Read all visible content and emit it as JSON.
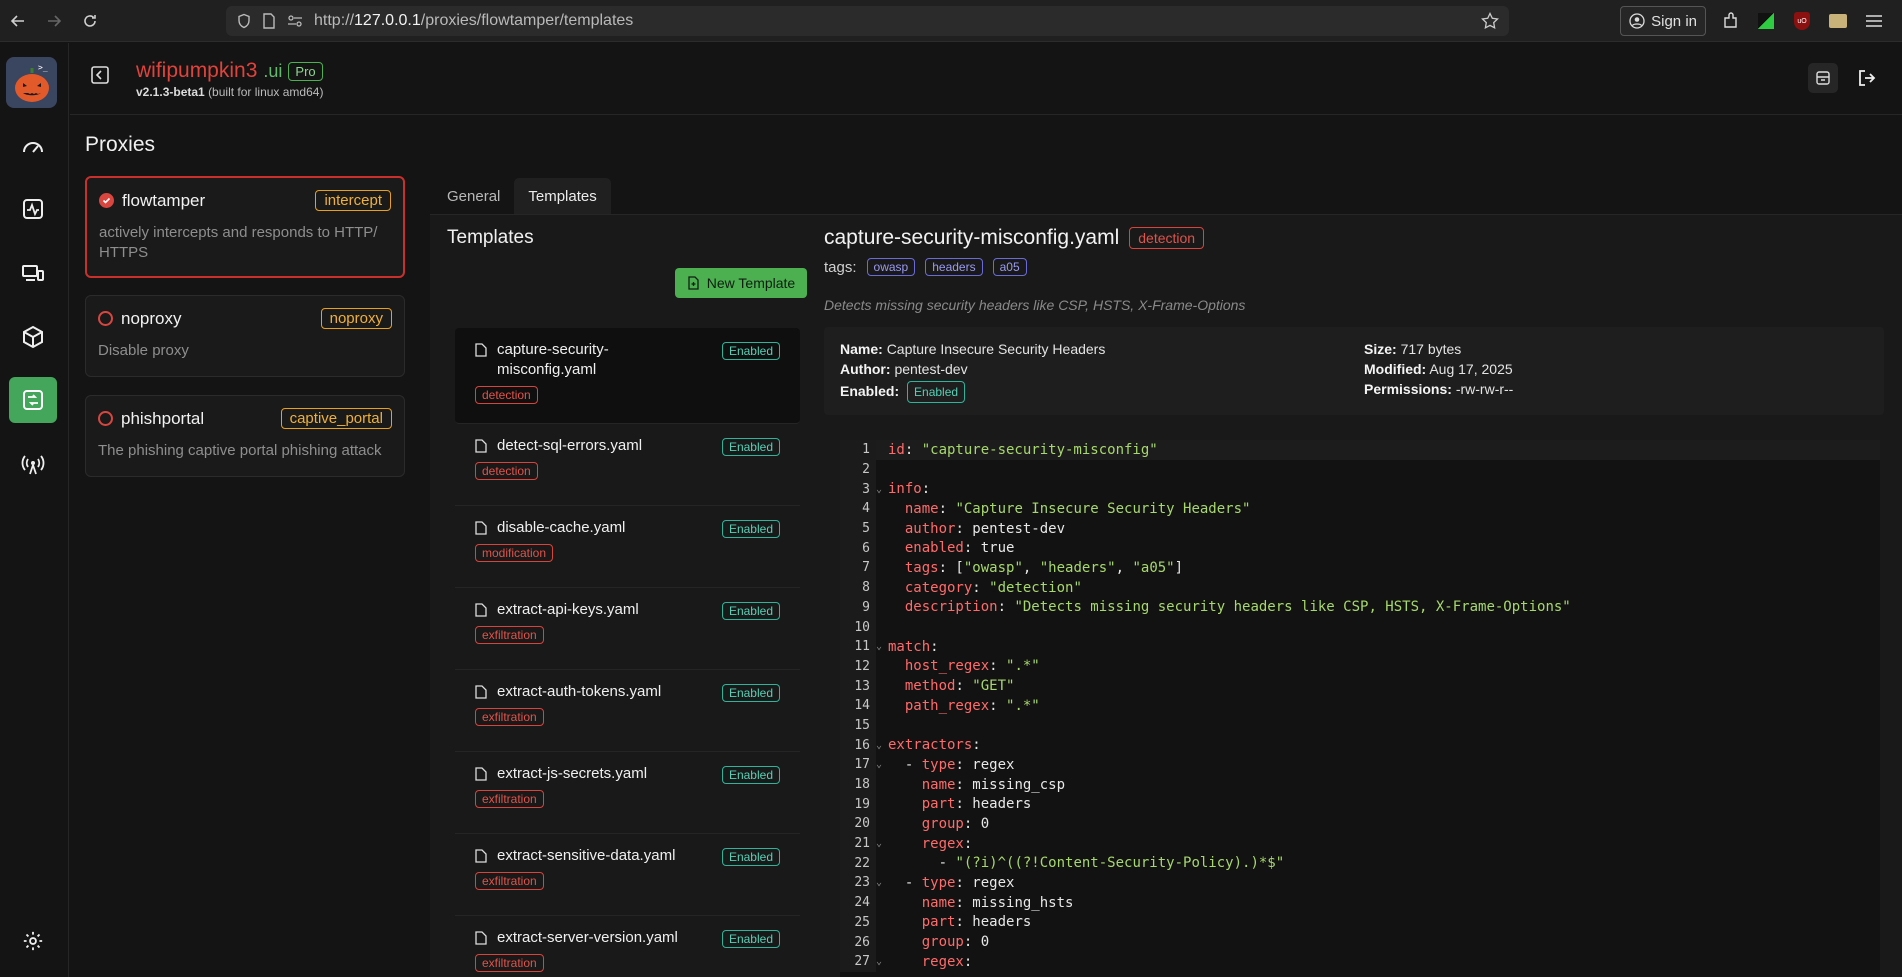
{
  "browser": {
    "url_prefix": "http://",
    "url_host": "127.0.0.1",
    "url_path": "/proxies/flowtamper/templates",
    "sign_in_label": "Sign in"
  },
  "header": {
    "brand_name": "wifipumpkin3",
    "brand_suffix": ".ui",
    "badge": "Pro",
    "version": "v2.1.3-beta1",
    "build": "(built for linux amd64)"
  },
  "page": {
    "title": "Proxies"
  },
  "proxies": [
    {
      "name": "flowtamper",
      "type": "intercept",
      "description": "actively intercepts and responds to HTTP/ HTTPS",
      "selected": true
    },
    {
      "name": "noproxy",
      "type": "noproxy",
      "description": "Disable proxy",
      "selected": false
    },
    {
      "name": "phishportal",
      "type": "captive_portal",
      "description": "The phishing captive portal phishing attack",
      "selected": false
    }
  ],
  "tabs": [
    "General",
    "Templates"
  ],
  "templates_panel": {
    "title": "Templates",
    "new_button": "New Template",
    "items": [
      {
        "name": "capture-security-misconfig.yaml",
        "status": "Enabled",
        "category": "detection"
      },
      {
        "name": "detect-sql-errors.yaml",
        "status": "Enabled",
        "category": "detection"
      },
      {
        "name": "disable-cache.yaml",
        "status": "Enabled",
        "category": "modification"
      },
      {
        "name": "extract-api-keys.yaml",
        "status": "Enabled",
        "category": "exfiltration"
      },
      {
        "name": "extract-auth-tokens.yaml",
        "status": "Enabled",
        "category": "exfiltration"
      },
      {
        "name": "extract-js-secrets.yaml",
        "status": "Enabled",
        "category": "exfiltration"
      },
      {
        "name": "extract-sensitive-data.yaml",
        "status": "Enabled",
        "category": "exfiltration"
      },
      {
        "name": "extract-server-version.yaml",
        "status": "Enabled",
        "category": "exfiltration"
      }
    ]
  },
  "detail": {
    "filename": "capture-security-misconfig.yaml",
    "category": "detection",
    "tags_label": "tags:",
    "tags": [
      "owasp",
      "headers",
      "a05"
    ],
    "description": "Detects missing security headers like CSP, HSTS, X-Frame-Options",
    "meta": {
      "name_label": "Name:",
      "name": "Capture Insecure Security Headers",
      "author_label": "Author:",
      "author": "pentest-dev",
      "enabled_label": "Enabled:",
      "enabled": "Enabled",
      "size_label": "Size:",
      "size": "717 bytes",
      "modified_label": "Modified:",
      "modified": "Aug 17, 2025",
      "permissions_label": "Permissions:",
      "permissions": "-rw-rw-r--"
    },
    "code_lines": [
      "id: \"capture-security-misconfig\"",
      "",
      "info:",
      "  name: \"Capture Insecure Security Headers\"",
      "  author: pentest-dev",
      "  enabled: true",
      "  tags: [\"owasp\", \"headers\", \"a05\"]",
      "  category: \"detection\"",
      "  description: \"Detects missing security headers like CSP, HSTS, X-Frame-Options\"",
      "",
      "match:",
      "  host_regex: \".*\"",
      "  method: \"GET\"",
      "  path_regex: \".*\"",
      "",
      "extractors:",
      "  - type: regex",
      "    name: missing_csp",
      "    part: headers",
      "    group: 0",
      "    regex:",
      "      - \"(?i)^((?!Content-Security-Policy).)*$\"",
      "  - type: regex",
      "    name: missing_hsts",
      "    part: headers",
      "    group: 0",
      "    regex:"
    ],
    "fold_lines": [
      3,
      11,
      16,
      17,
      21,
      23,
      27
    ]
  }
}
